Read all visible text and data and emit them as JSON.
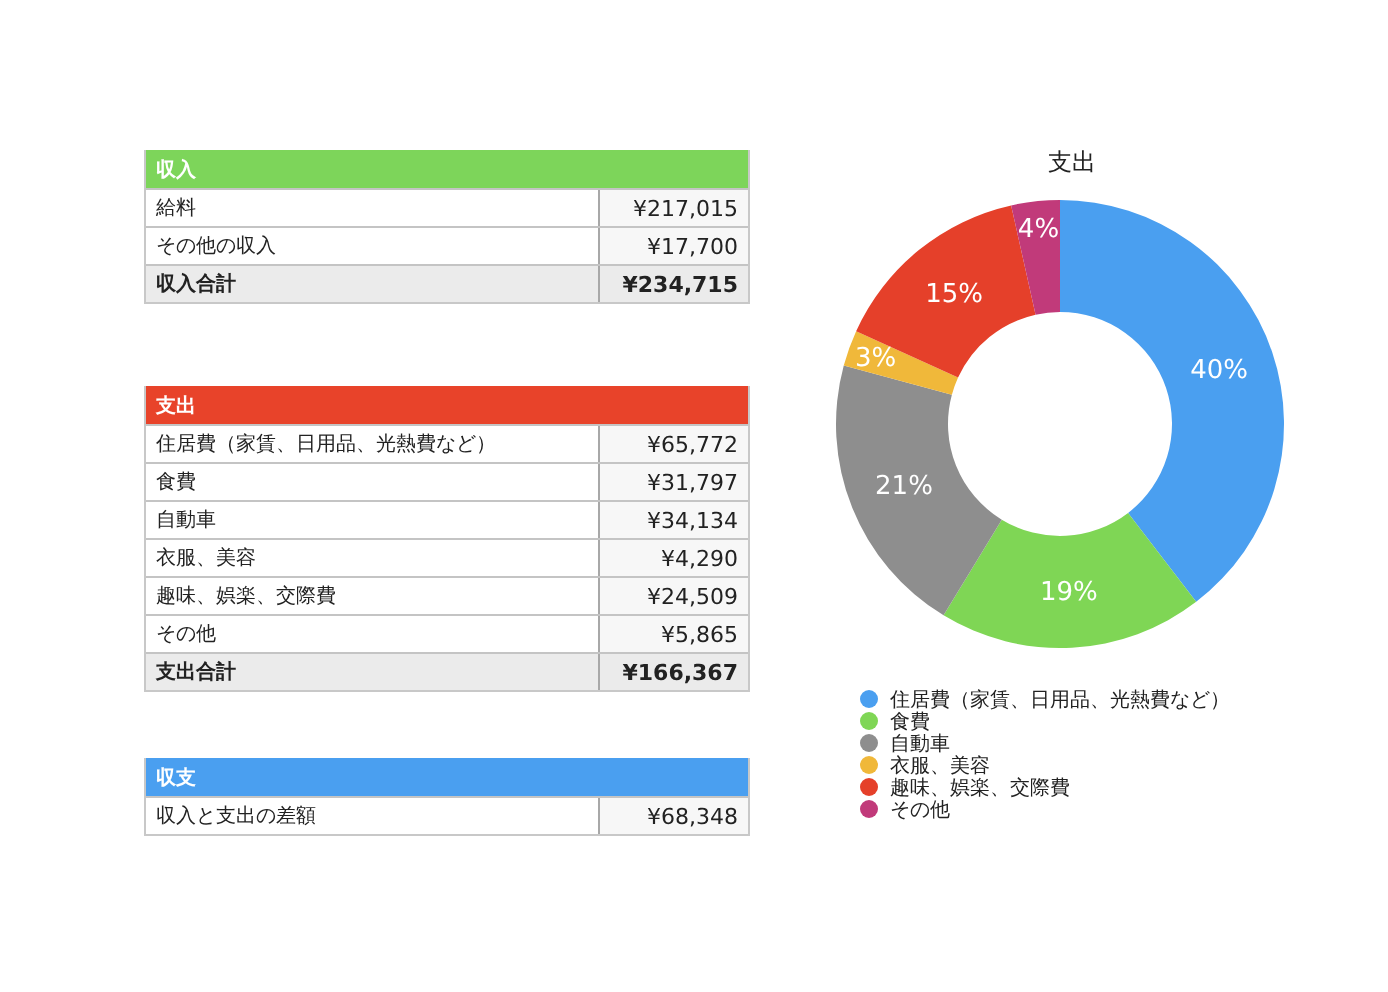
{
  "tables": [
    {
      "title": "収入",
      "color": "#7dd55a",
      "rows": [
        {
          "label": "給料",
          "value": "¥217,015"
        },
        {
          "label": "その他の収入",
          "value": "¥17,700"
        }
      ],
      "total": {
        "label": "収入合計",
        "value": "¥234,715"
      }
    },
    {
      "title": "支出",
      "color": "#e8432a",
      "rows": [
        {
          "label": "住居費（家賃、日用品、光熱費など）",
          "value": "¥65,772"
        },
        {
          "label": "食費",
          "value": "¥31,797"
        },
        {
          "label": "自動車",
          "value": "¥34,134"
        },
        {
          "label": "衣服、美容",
          "value": "¥4,290"
        },
        {
          "label": "趣味、娯楽、交際費",
          "value": "¥24,509"
        },
        {
          "label": "その他",
          "value": "¥5,865"
        }
      ],
      "total": {
        "label": "支出合計",
        "value": "¥166,367"
      }
    },
    {
      "title": "収支",
      "color": "#4a9ff0",
      "rows": [
        {
          "label": "収入と支出の差額",
          "value": "¥68,348"
        }
      ]
    }
  ],
  "chart": {
    "chart_data": {
      "type": "donut",
      "title": "支出",
      "categories": [
        "住居費（家賃、日用品、光熱費など）",
        "食費",
        "自動車",
        "衣服、美容",
        "趣味、娯楽、交際費",
        "その他"
      ],
      "colors": [
        "#4a9ff0",
        "#7fd655",
        "#8e8e8e",
        "#f0b83a",
        "#e5402a",
        "#c13a7a"
      ],
      "series": [
        {
          "values": [
            39.6,
            19.1,
            20.5,
            2.6,
            14.7,
            3.5
          ]
        }
      ],
      "value_labels": [
        "40%",
        "19%",
        "21%",
        "3%",
        "15%",
        "4%"
      ]
    }
  }
}
